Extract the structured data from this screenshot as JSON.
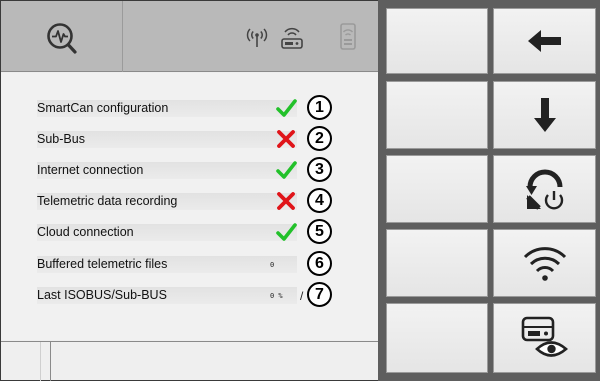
{
  "header": {
    "app_icon": "diagnostics-magnifier-icon",
    "status_icons": [
      "antenna-icon",
      "smartcan-device-icon",
      "wifi-router-icon"
    ]
  },
  "status_rows": [
    {
      "label": "SmartCan configuration",
      "status": "ok",
      "number": "1"
    },
    {
      "label": "Sub-Bus",
      "status": "error",
      "number": "2"
    },
    {
      "label": "Internet connection",
      "status": "ok",
      "number": "3"
    },
    {
      "label": "Telemetric data recording",
      "status": "error",
      "number": "4"
    },
    {
      "label": "Cloud connection",
      "status": "ok",
      "number": "5"
    },
    {
      "label": "Buffered telemetric files",
      "value": "0",
      "number": "6"
    },
    {
      "label": "Last ISOBUS/Sub-BUS",
      "value": "0 %",
      "slash": "/",
      "number": "7"
    }
  ],
  "colors": {
    "ok": "#22c12a",
    "error": "#e01419",
    "header": "#b9b9b9"
  },
  "buttons": [
    {
      "name": "empty-button-1",
      "icon": ""
    },
    {
      "name": "back-button",
      "icon": "arrow-left-icon"
    },
    {
      "name": "empty-button-2",
      "icon": ""
    },
    {
      "name": "down-button",
      "icon": "arrow-down-icon"
    },
    {
      "name": "empty-button-3",
      "icon": ""
    },
    {
      "name": "reset-power-button",
      "icon": "reset-power-icon"
    },
    {
      "name": "empty-button-4",
      "icon": ""
    },
    {
      "name": "wifi-button",
      "icon": "wifi-icon"
    },
    {
      "name": "empty-button-5",
      "icon": ""
    },
    {
      "name": "device-view-button",
      "icon": "device-eye-icon"
    }
  ]
}
